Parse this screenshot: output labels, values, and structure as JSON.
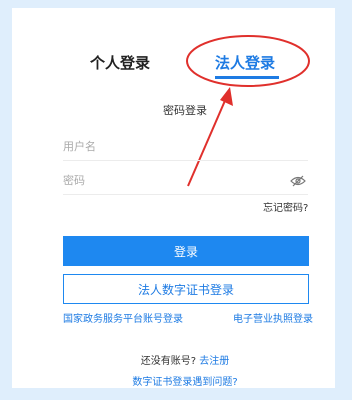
{
  "tabs": {
    "personal": "个人登录",
    "legal": "法人登录"
  },
  "subtitle": "密码登录",
  "form": {
    "username_placeholder": "用户名",
    "password_placeholder": "密码",
    "forgot": "忘记密码?"
  },
  "buttons": {
    "login": "登录",
    "cert_login": "法人数字证书登录"
  },
  "links": {
    "gov_account": "国家政务服务平台账号登录",
    "e_license": "电子营业执照登录"
  },
  "register": {
    "prompt": "还没有账号?",
    "link": "去注册"
  },
  "problem": "数字证书登录遇到问题?",
  "colors": {
    "accent": "#1e88f0",
    "annotation": "#e0302c",
    "background": "#dfeefc"
  }
}
